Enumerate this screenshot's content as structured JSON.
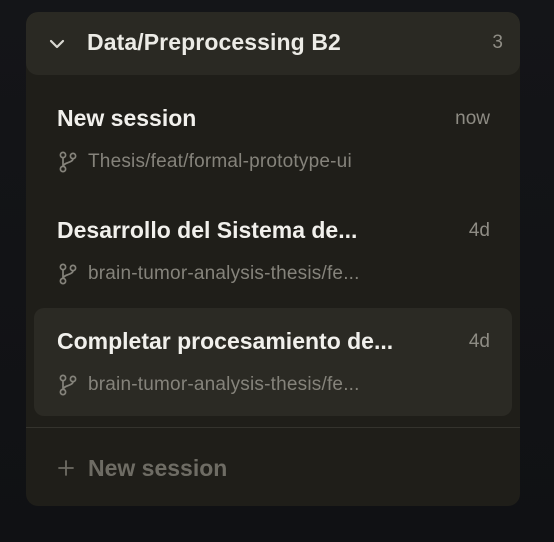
{
  "group": {
    "title": "Data/Preprocessing B2",
    "count": "3",
    "expanded_icon": "chevron-down-icon"
  },
  "sessions": [
    {
      "title": "New session",
      "time": "now",
      "branch": "Thesis/feat/formal-prototype-ui",
      "icon": "git-branch-icon",
      "active": false
    },
    {
      "title": "Desarrollo del Sistema de...",
      "time": "4d",
      "branch": "brain-tumor-analysis-thesis/fe...",
      "icon": "git-branch-icon",
      "active": false
    },
    {
      "title": "Completar procesamiento de...",
      "time": "4d",
      "branch": "brain-tumor-analysis-thesis/fe...",
      "icon": "git-branch-icon",
      "active": true
    }
  ],
  "footer": {
    "new_session_label": "New session",
    "icon": "plus-icon"
  },
  "colors": {
    "panel_bg": "#1f1e19",
    "header_bg": "#2a2923",
    "active_bg": "#2b2a24",
    "title_text": "#f1f0ec",
    "muted_text": "#85837b"
  }
}
